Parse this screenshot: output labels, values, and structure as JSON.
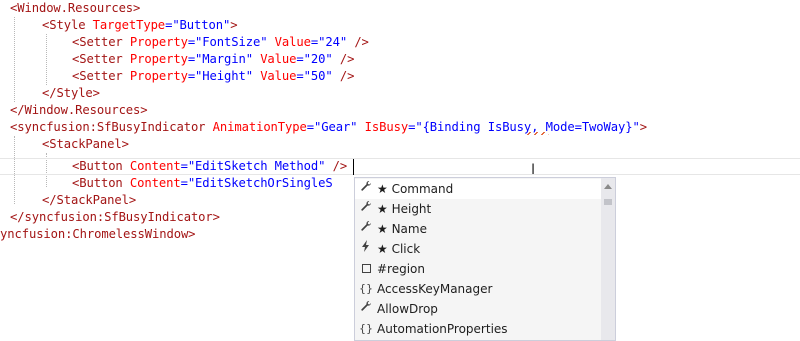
{
  "code": {
    "line1": {
      "tag": "<Window.Resources>"
    },
    "line2": {
      "open": "<Style ",
      "attr": "TargetType",
      "eq": "=",
      "val": "\"Button\"",
      "close": ">"
    },
    "line3": {
      "open": "<Setter ",
      "attr1": "Property",
      "val1": "=\"FontSize\"",
      "attr2": " Value",
      "val2": "=\"24\"",
      "close": " />"
    },
    "line4": {
      "open": "<Setter ",
      "attr1": "Property",
      "val1": "=\"Margin\"",
      "attr2": " Value",
      "val2": "=\"20\"",
      "close": " />"
    },
    "line5": {
      "open": "<Setter ",
      "attr1": "Property",
      "val1": "=\"Height\"",
      "attr2": " Value",
      "val2": "=\"50\"",
      "close": " />"
    },
    "line6": {
      "tag": "</Style>"
    },
    "line7": {
      "tag": "</Window.Resources>"
    },
    "line8": {
      "open": "<syncfusion:SfBusyIndicator ",
      "attr1": "AnimationType",
      "val1": "=\"Gear\"",
      "attr2": " IsBusy",
      "val2a": "=\"{Binding ",
      "val2b": "IsBusy",
      "val2c": ", Mode=TwoWay}\"",
      "close": ">"
    },
    "line9": {
      "tag": "<StackPanel>"
    },
    "line10": {
      "open": "<Button ",
      "attr": "Content",
      "val": "=\"EditSketch Method\"",
      "close": " />"
    },
    "line11": {
      "open": "<Button ",
      "attr": "Content",
      "val": "=\"EditSketchOrSingleS"
    },
    "line12": {
      "tag": "</StackPanel>"
    },
    "line13": {
      "tag": "</syncfusion:SfBusyIndicator>"
    },
    "line14": {
      "tag": "yncfusion:ChromelessWindow>"
    }
  },
  "completion": {
    "items": [
      {
        "icon": "wrench-icon",
        "glyph": "🔧",
        "label": "★ Command",
        "selected": true
      },
      {
        "icon": "wrench-icon",
        "glyph": "🔧",
        "label": "★ Height"
      },
      {
        "icon": "wrench-icon",
        "glyph": "🔧",
        "label": "★ Name"
      },
      {
        "icon": "lightning-icon",
        "glyph": "ϟ",
        "label": "★ Click"
      },
      {
        "icon": "region-icon",
        "glyph": "",
        "label": "#region"
      },
      {
        "icon": "braces-icon",
        "glyph": "{}",
        "label": "AccessKeyManager"
      },
      {
        "icon": "wrench-icon",
        "glyph": "🔧",
        "label": "AllowDrop"
      },
      {
        "icon": "braces-icon",
        "glyph": "{}",
        "label": "AutomationProperties"
      }
    ]
  },
  "colors": {
    "element": "#a31515",
    "attribute": "#ff0000",
    "value": "#0000ff",
    "popup_bg": "#f5f5f5",
    "popup_border": "#cccedb"
  }
}
